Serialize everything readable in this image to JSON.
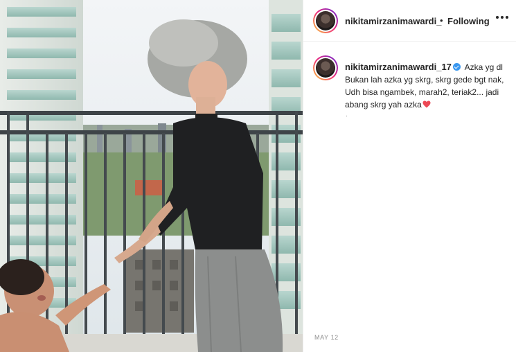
{
  "post": {
    "photo_alt_icon": "photo",
    "date": "MAY 12"
  },
  "header": {
    "username": "nikitamirzanimawardi_",
    "separator": "•",
    "follow_label": "Following",
    "more_icon": "more-dots-icon"
  },
  "caption": {
    "username": "nikitamirzanimawardi_17",
    "verified_icon": "verified-badge-icon",
    "text": "Azka yg dl Bukan lah azka yg skrg, skrg gede bgt nak, Udh bisa ngambek, marah2, teriak2... jadi abang skrg yah azka",
    "emoji_icon": "red-heart-icon",
    "trailing": "."
  },
  "colors": {
    "link": "#262626",
    "verified": "#3897f0",
    "heart": "#ed4956",
    "muted": "#8e8e8e"
  }
}
